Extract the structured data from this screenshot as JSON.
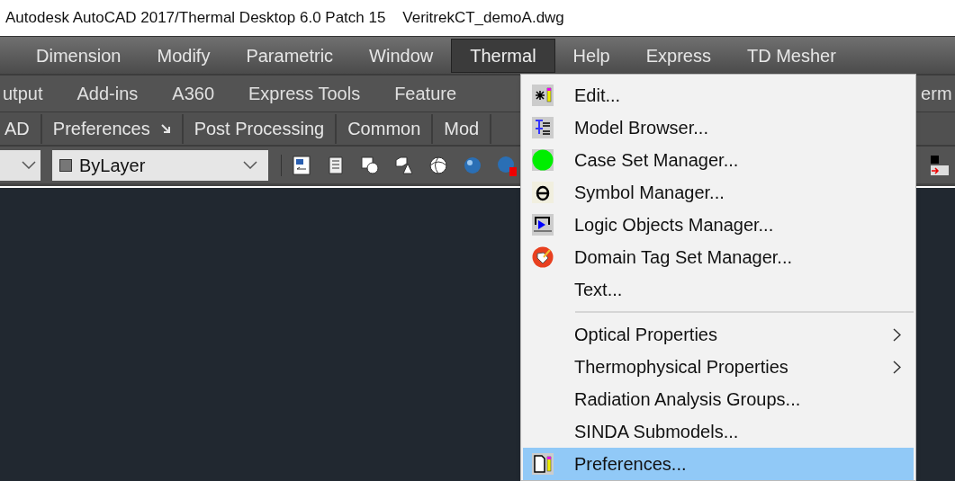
{
  "window": {
    "title": "Autodesk AutoCAD 2017/Thermal Desktop 6.0 Patch 15    VeritrekCT_demoA.dwg"
  },
  "menu_bar": [
    {
      "label": "Dimension",
      "selected": false
    },
    {
      "label": "Modify",
      "selected": false
    },
    {
      "label": "Parametric",
      "selected": false
    },
    {
      "label": "Window",
      "selected": false
    },
    {
      "label": "Thermal",
      "selected": true
    },
    {
      "label": "Help",
      "selected": false
    },
    {
      "label": "Express",
      "selected": false
    },
    {
      "label": "TD Mesher",
      "selected": false
    }
  ],
  "ribbon_tabs": [
    "utput",
    "Add-ins",
    "A360",
    "Express Tools",
    "Feature",
    "erm"
  ],
  "ribbon_panels": [
    {
      "label": "AD",
      "launcher": false
    },
    {
      "label": "Preferences",
      "launcher": true
    },
    {
      "label": "Post Processing",
      "launcher": false
    },
    {
      "label": "Common",
      "launcher": false
    },
    {
      "label": "Mod",
      "launcher": false
    }
  ],
  "toolbar": {
    "linetype_dropdown": "ByLayer"
  },
  "thermal_menu": [
    {
      "kind": "item",
      "label": "Edit...",
      "submenu": false,
      "selected": false
    },
    {
      "kind": "item",
      "label": "Model Browser...",
      "submenu": false,
      "selected": false
    },
    {
      "kind": "item",
      "label": "Case Set Manager...",
      "submenu": false,
      "selected": false
    },
    {
      "kind": "item",
      "label": "Symbol Manager...",
      "submenu": false,
      "selected": false
    },
    {
      "kind": "item",
      "label": "Logic Objects Manager...",
      "submenu": false,
      "selected": false
    },
    {
      "kind": "item",
      "label": "Domain Tag Set Manager...",
      "submenu": false,
      "selected": false
    },
    {
      "kind": "item",
      "label": "Text...",
      "submenu": false,
      "selected": false
    },
    {
      "kind": "separator"
    },
    {
      "kind": "item",
      "label": "Optical Properties",
      "submenu": true,
      "selected": false
    },
    {
      "kind": "item",
      "label": "Thermophysical Properties",
      "submenu": true,
      "selected": false
    },
    {
      "kind": "item",
      "label": "Radiation Analysis Groups...",
      "submenu": false,
      "selected": false
    },
    {
      "kind": "item",
      "label": "SINDA Submodels...",
      "submenu": false,
      "selected": false
    },
    {
      "kind": "item",
      "label": "Preferences...",
      "submenu": false,
      "selected": true
    }
  ]
}
